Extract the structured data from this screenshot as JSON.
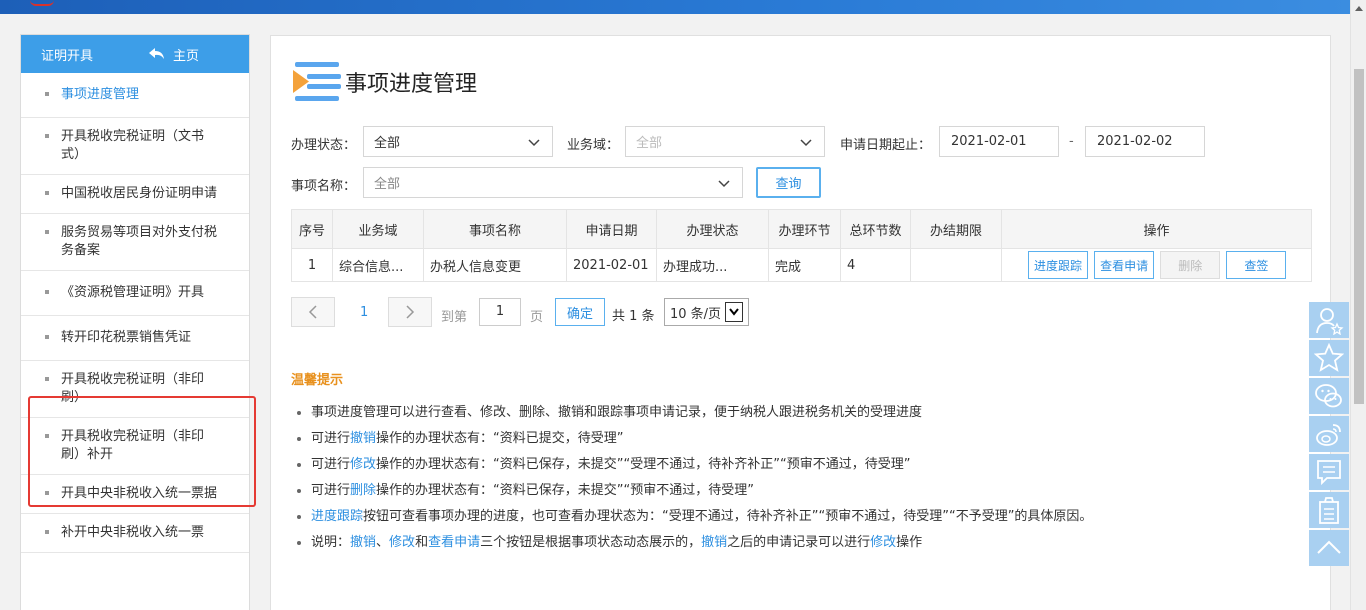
{
  "sidebar": {
    "header": {
      "title": "证明开具",
      "home_label": "主页"
    },
    "items": [
      {
        "label": "事项进度管理",
        "active": true
      },
      {
        "label": "开具税收完税证明（文书式）"
      },
      {
        "label": "中国税收居民身份证明申请"
      },
      {
        "label": "服务贸易等项目对外支付税务备案"
      },
      {
        "label": "《资源税管理证明》开具"
      },
      {
        "label": "转开印花税票销售凭证"
      },
      {
        "label": "开具税收完税证明（非印刷）"
      },
      {
        "label": "开具税收完税证明（非印刷）补开"
      },
      {
        "label": "开具中央非税收入统一票据"
      },
      {
        "label": "补开中央非税收入统一票"
      }
    ]
  },
  "main": {
    "title": "事项进度管理",
    "filters": {
      "status_label": "办理状态：",
      "status_value": "全部",
      "domain_label": "业务域：",
      "domain_value": "全部",
      "date_label": "申请日期起止：",
      "date_from": "2021-02-01",
      "date_sep": "-",
      "date_to": "2021-02-02",
      "name_label": "事项名称：",
      "name_value": "全部",
      "query_button": "查询"
    },
    "table": {
      "headers": [
        "序号",
        "业务域",
        "事项名称",
        "申请日期",
        "办理状态",
        "办理环节",
        "总环节数",
        "办结期限",
        "操作"
      ],
      "rows": [
        {
          "no": "1",
          "domain": "综合信息...",
          "name": "办税人信息变更",
          "date": "2021-02-01",
          "status": "办理成功...",
          "stage": "完成",
          "total": "4",
          "deadline": ""
        }
      ],
      "ops": {
        "track": "进度跟踪",
        "view": "查看申请",
        "delete": "删除",
        "sign": "查签"
      }
    },
    "pager": {
      "current_page": "1",
      "goto_label": "到第",
      "goto_value": "1",
      "page_unit": "页",
      "confirm": "确定",
      "total": "共 1 条",
      "page_size": "10 条/页"
    },
    "tips": {
      "title": "温馨提示",
      "t1": "事项进度管理可以进行查看、修改、删除、撤销和跟踪事项申请记录，便于纳税人跟进税务机关的受理进度",
      "t2a": "可进行",
      "t2b": "撤销",
      "t2c": "操作的办理状态有：“资料已提交，待受理”",
      "t3a": "可进行",
      "t3b": "修改",
      "t3c": "操作的办理状态有：“资料已保存，未提交”“受理不通过，待补齐补正”“预审不通过，待受理”",
      "t4a": "可进行",
      "t4b": "删除",
      "t4c": "操作的办理状态有：“资料已保存，未提交”“预审不通过，待受理”",
      "t5a": "进度跟踪",
      "t5b": "按钮可查看事项办理的进度，也可查看办理状态为：“受理不通过，待补齐补正”“预审不通过，待受理”“不予受理”的具体原因。",
      "t6a": "说明：",
      "t6b": "撤销",
      "t6c": "、",
      "t6d": "修改",
      "t6e": "和",
      "t6f": "查看申请",
      "t6g": "三个按钮是根据事项状态动态展示的，",
      "t6h": "撤销",
      "t6i": "之后的申请记录可以进行",
      "t6j": "修改",
      "t6k": "操作"
    }
  },
  "floatbar": [
    "user-star-icon",
    "star-icon",
    "wechat-icon",
    "weibo-icon",
    "message-icon",
    "clipboard-icon",
    "back-to-top-icon"
  ],
  "colors": {
    "accent": "#2d8fe0",
    "sidebar_header": "#3d9ee8",
    "tip_title": "#e8911e",
    "highlight_border": "#e53a33",
    "float_button": "#a9d0f1"
  }
}
